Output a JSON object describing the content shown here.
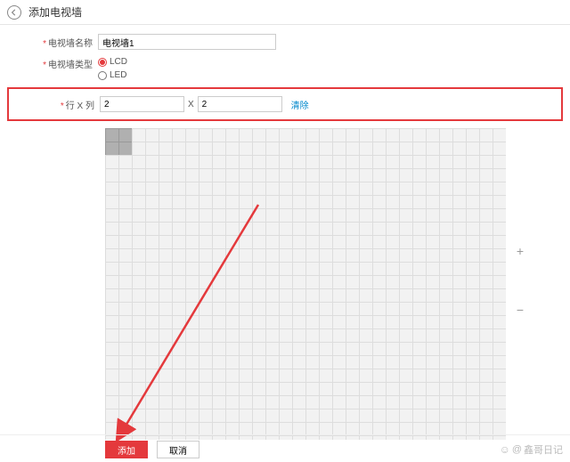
{
  "header": {
    "title": "添加电视墙"
  },
  "form": {
    "name_label": "电视墙名称",
    "name_value": "电视墙1",
    "type_label": "电视墙类型",
    "type_options": {
      "lcd": "LCD",
      "led": "LED"
    },
    "grid_label": "行 X 列",
    "rows_value": "2",
    "cols_value": "2",
    "x_separator": "X",
    "clear_link": "清除"
  },
  "zoom": {
    "plus": "+",
    "minus": "−"
  },
  "footer": {
    "add": "添加",
    "cancel": "取消"
  },
  "watermark": {
    "text": "鑫哥日记"
  }
}
